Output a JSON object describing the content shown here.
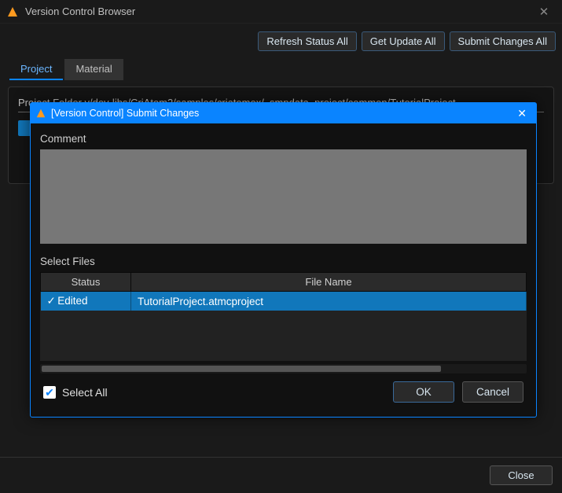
{
  "main": {
    "title": "Version Control Browser",
    "toolbar": {
      "refresh": "Refresh Status All",
      "update": "Get Update All",
      "submit": "Submit Changes All"
    },
    "tabs": {
      "project": "Project",
      "material": "Material",
      "active": "project"
    },
    "project_path_label": "Project Folder  v/dev-libs/CriAtom2/samples/criatomex/_smpdata_project/common/TutorialProject",
    "footer_close": "Close"
  },
  "modal": {
    "title": "[Version Control] Submit Changes",
    "comment_label": "Comment",
    "comment_value": "",
    "select_files_label": "Select Files",
    "columns": {
      "status": "Status",
      "filename": "File Name"
    },
    "rows": [
      {
        "checked": true,
        "status": "Edited",
        "filename": "TutorialProject.atmcproject"
      }
    ],
    "select_all_label": "Select All",
    "select_all_checked": true,
    "ok": "OK",
    "cancel": "Cancel"
  },
  "colors": {
    "accent": "#0a84ff",
    "selection": "#1177bb"
  }
}
